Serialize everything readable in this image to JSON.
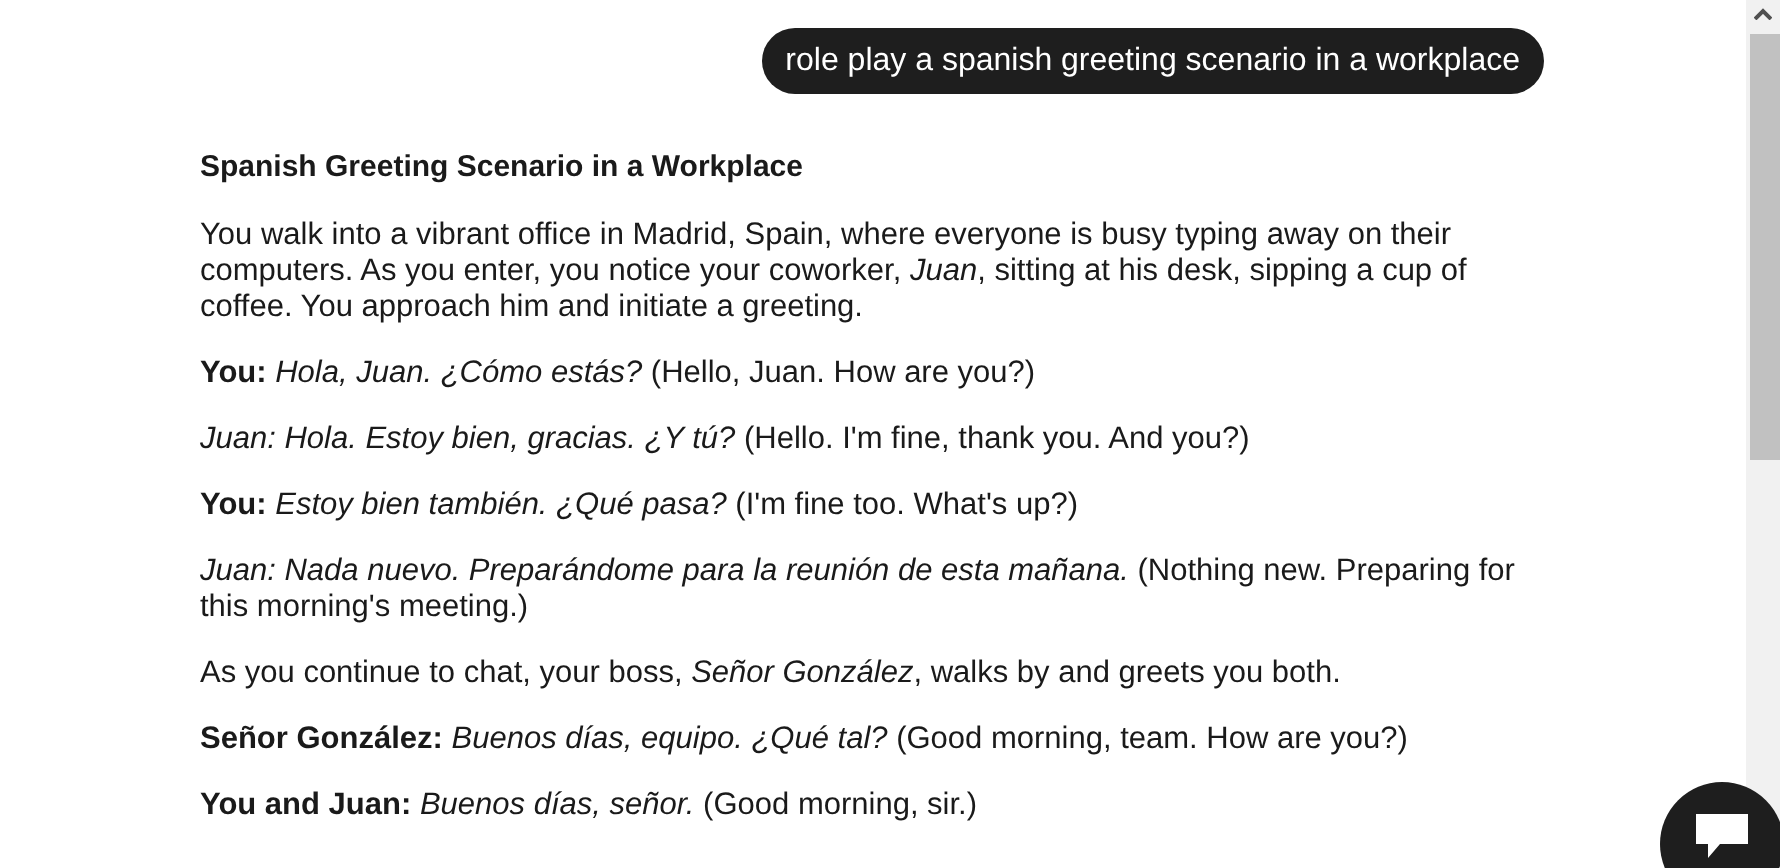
{
  "user_message": "role play a spanish greeting scenario in a workplace",
  "response": {
    "title": "Spanish Greeting Scenario in a Workplace",
    "paragraphs": [
      "You walk into a vibrant office in Madrid, Spain, where everyone is busy typing away on their computers. As you enter, you notice your coworker, *Juan*, sitting at his desk, sipping a cup of coffee. You approach him and initiate a greeting.",
      "**You:** *Hola, Juan. ¿Cómo estás?* (Hello, Juan. How are you?)",
      "*Juan: Hola. Estoy bien, gracias. ¿Y tú?* (Hello. I'm fine, thank you. And you?)",
      "**You:** *Estoy bien también. ¿Qué pasa?* (I'm fine too. What's up?)",
      "*Juan: Nada nuevo. Preparándome para la reunión de esta mañana.* (Nothing new. Preparing for this morning's meeting.)",
      "As you continue to chat, your boss, *Señor González*, walks by and greets you both.",
      "**Señor González:** *Buenos días, equipo. ¿Qué tal?* (Good morning, team. How are you?)",
      "**You and Juan:** *Buenos días, señor.* (Good morning, sir.)"
    ]
  }
}
